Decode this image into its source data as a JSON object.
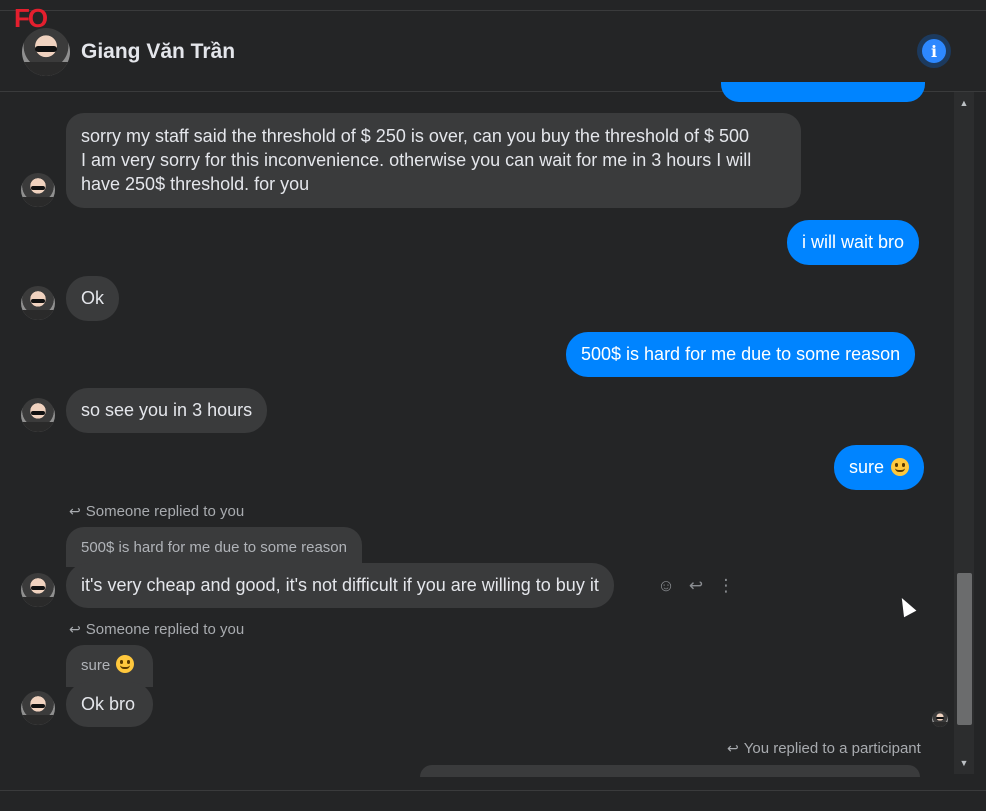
{
  "header": {
    "contact_name": "Giang Văn Trần",
    "corner_badge": "FO",
    "info_icon": "info-icon"
  },
  "messages": [
    {
      "id": "m1",
      "from": "contact",
      "text": "sorry my staff said the threshold of $ 250 is over, can you buy the threshold of $ 500",
      "text2": "I am very sorry for this inconvenience. otherwise you can wait for me in 3 hours I will",
      "text3": "have 250$ threshold. for you"
    },
    {
      "id": "m2",
      "from": "me",
      "text": "i will wait bro"
    },
    {
      "id": "m3",
      "from": "contact",
      "text": "Ok"
    },
    {
      "id": "m4",
      "from": "me",
      "text": "500$ is hard for me due to some reason"
    },
    {
      "id": "m5",
      "from": "contact",
      "text": "so see you in 3 hours"
    },
    {
      "id": "m6",
      "from": "me",
      "text": "sure",
      "emoji": "slightly-smiling-face"
    },
    {
      "id": "m7",
      "from": "contact",
      "reply_label": "Someone replied to you",
      "quoted": "500$ is hard for me due to some reason",
      "text": "it's very cheap and good, it's not difficult if you are willing to buy it"
    },
    {
      "id": "m8",
      "from": "contact",
      "reply_label": "Someone replied to you",
      "quoted": "sure",
      "quoted_emoji": "slightly-smiling-face",
      "text": "Ok bro"
    },
    {
      "id": "m9",
      "from": "me",
      "reply_label": "You replied to a participant"
    }
  ],
  "hover_actions": [
    "emoji-reaction-icon",
    "reply-icon",
    "more-options-icon"
  ],
  "colors": {
    "background": "#242526",
    "incoming_bubble": "#3a3b3c",
    "outgoing_bubble": "#0084ff",
    "accent": "#2d88ff"
  }
}
